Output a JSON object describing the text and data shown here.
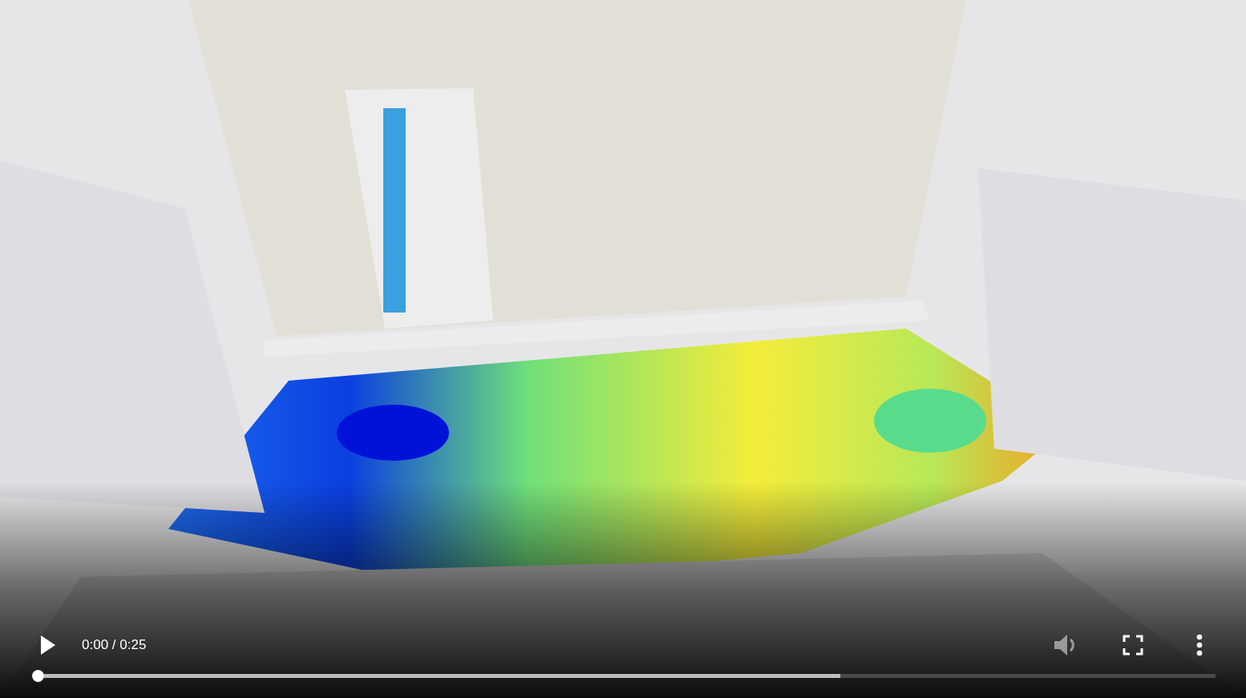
{
  "controls": {
    "playing": false,
    "time": "0:00 / 0:25",
    "progress": {
      "level": 0
    },
    "buffered": {
      "level": 0.68
    },
    "volume": {
      "disabled": true
    }
  }
}
